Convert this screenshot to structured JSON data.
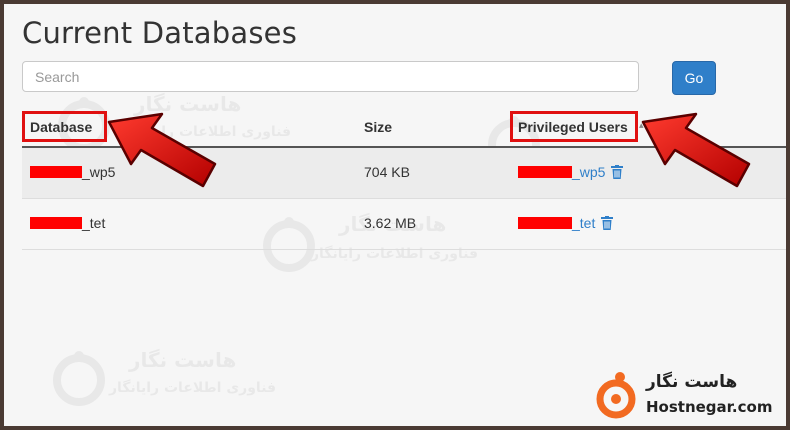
{
  "page": {
    "title": "Current Databases"
  },
  "search": {
    "placeholder": "Search",
    "button_label": "Go"
  },
  "table": {
    "columns": [
      "Database",
      "Size",
      "Privileged Users"
    ],
    "rows": [
      {
        "database_suffix": "_wp5",
        "size": "704 KB",
        "user_suffix": "_wp5"
      },
      {
        "database_suffix": "_tet",
        "size": "3.62 MB",
        "user_suffix": "_tet"
      }
    ]
  },
  "watermark": {
    "brand_fa": "هاست نگار",
    "subtitle_fa": "فناوری اطلاعات رایانگار"
  },
  "logo": {
    "name_fa": "هاست نگار",
    "name_en": "Hostnegar.com"
  },
  "colors": {
    "accent": "#2f7fc9",
    "highlight": "#e01010",
    "redaction": "#ff0000",
    "logo_orange": "#f26a21"
  },
  "icons": {
    "delete": "trash-icon",
    "sort": "sort-caret-icon"
  }
}
